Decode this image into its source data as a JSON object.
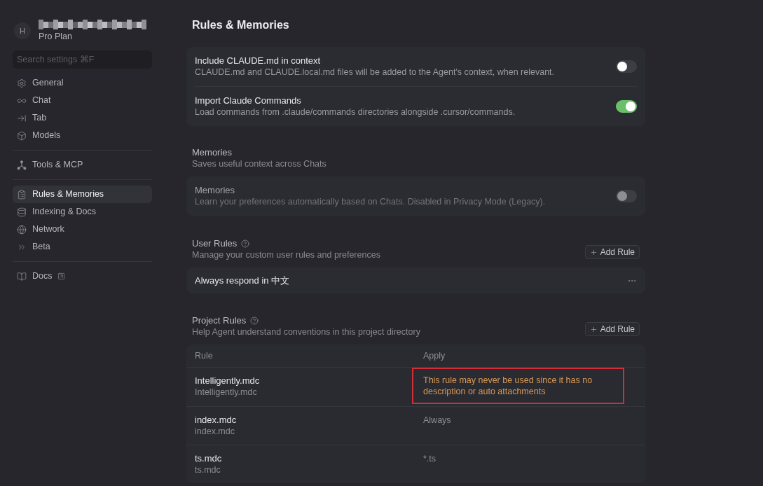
{
  "sidebar": {
    "profile": {
      "avatar": "H",
      "plan": "Pro Plan"
    },
    "search": {
      "placeholder": "Search settings ⌘F"
    },
    "groups": [
      {
        "items": [
          {
            "label": "General",
            "selected": false,
            "external": false
          },
          {
            "label": "Chat",
            "selected": false,
            "external": false
          },
          {
            "label": "Tab",
            "selected": false,
            "external": false
          },
          {
            "label": "Models",
            "selected": false,
            "external": false
          }
        ]
      },
      {
        "items": [
          {
            "label": "Tools & MCP",
            "selected": false,
            "external": false
          }
        ]
      },
      {
        "items": [
          {
            "label": "Rules & Memories",
            "selected": true,
            "external": false
          },
          {
            "label": "Indexing & Docs",
            "selected": false,
            "external": false
          },
          {
            "label": "Network",
            "selected": false,
            "external": false
          },
          {
            "label": "Beta",
            "selected": false,
            "external": false
          }
        ]
      },
      {
        "items": [
          {
            "label": "Docs",
            "selected": false,
            "external": true
          }
        ]
      }
    ]
  },
  "page": {
    "title": "Rules & Memories"
  },
  "claude_settings": [
    {
      "title": "Include CLAUDE.md in context",
      "description": "CLAUDE.md and CLAUDE.local.md files will be added to the Agent's context, when relevant.",
      "on": false,
      "disabled": false
    },
    {
      "title": "Import Claude Commands",
      "description": "Load commands from .claude/commands directories alongside .cursor/commands.",
      "on": true,
      "disabled": false
    }
  ],
  "memories": {
    "title": "Memories",
    "subtitle": "Saves useful context across Chats",
    "settings": [
      {
        "title": "Memories",
        "description": "Learn your preferences automatically based on Chats. Disabled in Privacy Mode (Legacy).",
        "on": false,
        "disabled": true
      }
    ]
  },
  "user_rules": {
    "title": "User Rules",
    "subtitle": "Manage your custom user rules and preferences",
    "add_button": "Add Rule",
    "rules": [
      {
        "text": "Always respond in 中文"
      }
    ]
  },
  "project_rules": {
    "title": "Project Rules",
    "subtitle": "Help Agent understand conventions in this project directory",
    "add_button": "Add Rule",
    "table": {
      "columns": [
        "Rule",
        "Apply"
      ],
      "rows": [
        {
          "name": "Intelligently.mdc",
          "file": "Intelligently.mdc",
          "apply": "This rule may never be used since it has no description or auto attachments",
          "warning": true,
          "highlighted": true
        },
        {
          "name": "index.mdc",
          "file": "index.mdc",
          "apply": "Always",
          "warning": false,
          "highlighted": false
        },
        {
          "name": "ts.mdc",
          "file": "ts.mdc",
          "apply": "*.ts",
          "warning": false,
          "highlighted": false
        }
      ]
    }
  }
}
